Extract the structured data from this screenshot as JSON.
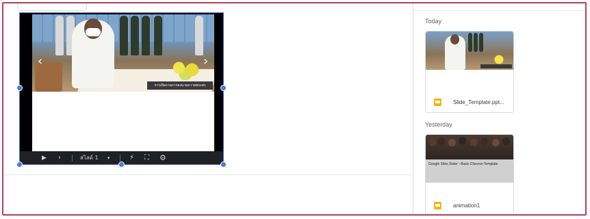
{
  "player": {
    "caption": "การเปิดงานการลงนามถวายพระพร",
    "slide_label": "สไลด์ 1",
    "prev_arrow": "‹",
    "next_arrow": "›"
  },
  "panel": {
    "sections": [
      {
        "heading": "Today",
        "file": "Slide_Template.ppt..."
      },
      {
        "heading": "Yesterday",
        "file": "animation1",
        "thumb_text": "Google Sites Slider - Basic Chevron Template"
      }
    ]
  },
  "colors": {
    "accent": "#4a7be0",
    "frame": "#b0405e",
    "slides_icon": "#f4b400"
  }
}
